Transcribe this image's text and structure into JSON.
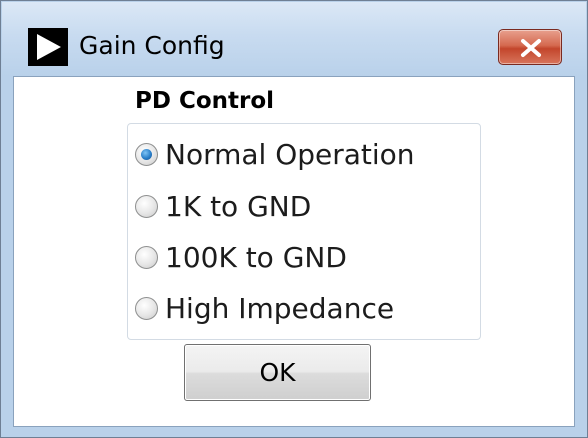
{
  "window": {
    "title": "Gain Config",
    "icon": "play-triangle-icon",
    "close_icon": "close-x-icon"
  },
  "group": {
    "label": "PD Control",
    "options": [
      {
        "label": "Normal Operation",
        "selected": true
      },
      {
        "label": "1K to GND",
        "selected": false
      },
      {
        "label": "100K to GND",
        "selected": false
      },
      {
        "label": "High Impedance",
        "selected": false
      }
    ]
  },
  "buttons": {
    "ok_label": "OK"
  },
  "colors": {
    "titlebar": "#b9d1ea",
    "close_button": "#c3462c",
    "radio_selected": "#2a7fc9"
  }
}
